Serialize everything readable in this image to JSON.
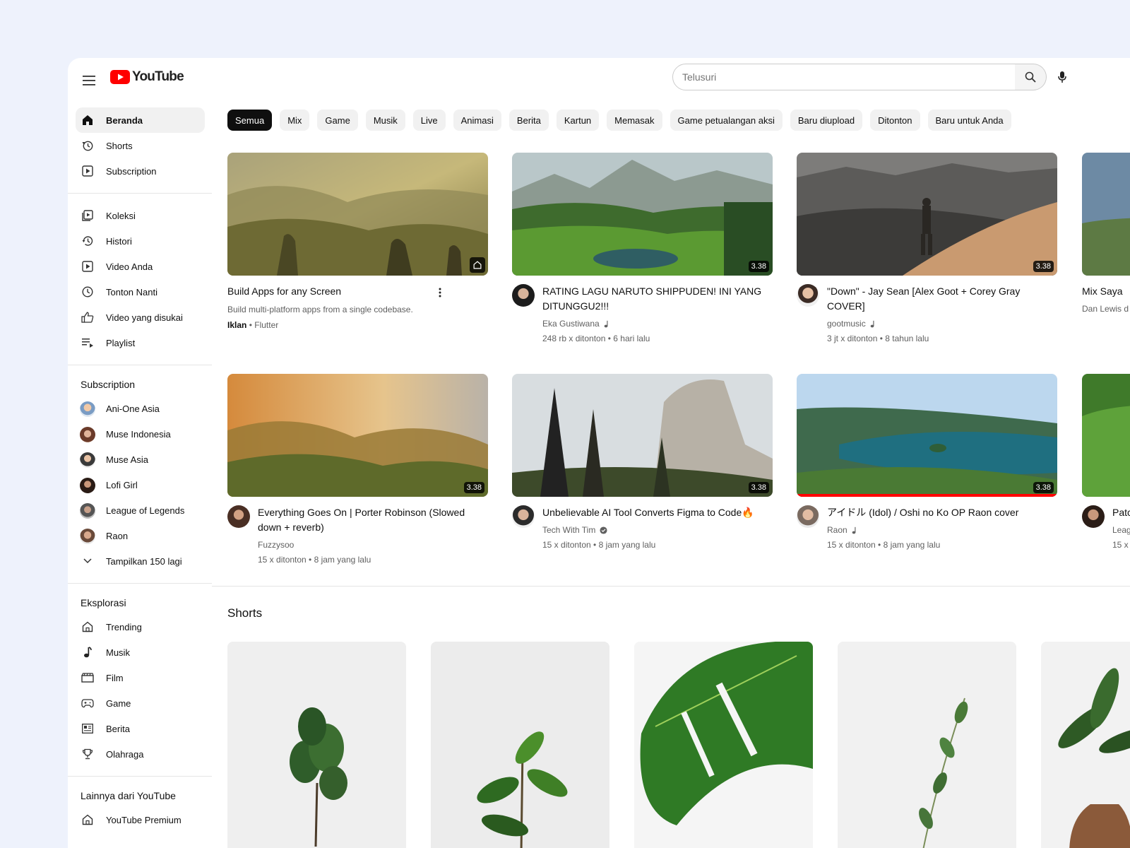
{
  "header": {
    "logo_text": "YouTube",
    "search_placeholder": "Telusuri"
  },
  "sidebar": {
    "main": [
      {
        "label": "Beranda",
        "icon": "home-icon"
      },
      {
        "label": "Shorts",
        "icon": "shorts-icon"
      },
      {
        "label": "Subscription",
        "icon": "subscription-icon"
      }
    ],
    "library": [
      {
        "label": "Koleksi",
        "icon": "library-icon"
      },
      {
        "label": "Histori",
        "icon": "history-icon"
      },
      {
        "label": "Video Anda",
        "icon": "your-videos-icon"
      },
      {
        "label": "Tonton Nanti",
        "icon": "clock-icon"
      },
      {
        "label": "Video yang disukai",
        "icon": "thumbs-up-icon"
      },
      {
        "label": "Playlist",
        "icon": "playlist-icon"
      }
    ],
    "subscription_title": "Subscription",
    "subscriptions": [
      {
        "label": "Ani-One Asia"
      },
      {
        "label": "Muse Indonesia"
      },
      {
        "label": "Muse Asia"
      },
      {
        "label": "Lofi Girl"
      },
      {
        "label": "League of Legends"
      },
      {
        "label": "Raon"
      }
    ],
    "show_more": "Tampilkan 150 lagi",
    "explore_title": "Eksplorasi",
    "explore": [
      {
        "label": "Trending",
        "icon": "trending-icon"
      },
      {
        "label": "Musik",
        "icon": "music-note-icon"
      },
      {
        "label": "Film",
        "icon": "film-icon"
      },
      {
        "label": "Game",
        "icon": "gamepad-icon"
      },
      {
        "label": "Berita",
        "icon": "news-icon"
      },
      {
        "label": "Olahraga",
        "icon": "trophy-icon"
      }
    ],
    "more_title": "Lainnya dari YouTube",
    "more": [
      {
        "label": "YouTube Premium",
        "icon": "premium-icon"
      }
    ]
  },
  "chips": [
    "Semua",
    "Mix",
    "Game",
    "Musik",
    "Live",
    "Animasi",
    "Berita",
    "Kartun",
    "Memasak",
    "Game petualangan aksi",
    "Baru diupload",
    "Ditonton",
    "Baru untuk Anda"
  ],
  "videos": [
    {
      "title": "Build Apps for any Screen",
      "desc": "Build multi-platform apps from a single codebase.",
      "ad_label": "Iklan",
      "sponsor": "Flutter"
    },
    {
      "title": "RATING LAGU NARUTO SHIPPUDEN! INI YANG DITUNGGU2!!!",
      "channel": "Eka Gustiwana",
      "stats": "248 rb x ditonton • 6 hari lalu",
      "duration": "3.38"
    },
    {
      "title": "\"Down\" - Jay Sean [Alex Goot + Corey Gray COVER]",
      "channel": "gootmusic",
      "stats": "3 jt x ditonton • 8 tahun lalu",
      "duration": "3.38"
    },
    {
      "title": "Mix Saya",
      "channel": "Dan Lewis d"
    },
    {
      "title": "Everything Goes On | Porter Robinson (Slowed down + reverb)",
      "channel": "Fuzzysoo",
      "stats": "15 x ditonton • 8 jam yang lalu",
      "duration": "3.38"
    },
    {
      "title": "Unbelievable AI Tool Converts Figma to Code🔥",
      "channel": "Tech With Tim",
      "stats": "15 x ditonton • 8 jam yang lalu",
      "duration": "3.38"
    },
    {
      "title": "アイドル (Idol) / Oshi no Ko OP  Raon cover",
      "channel": "Raon",
      "stats": "15 x ditonton • 8 jam yang lalu",
      "duration": "3.38",
      "watch_progress": 1.0
    },
    {
      "title": "Patc",
      "channel": "Leag",
      "stats": "15 x"
    }
  ],
  "shorts_title": "Shorts",
  "colors": {
    "brand_red": "#ff0000",
    "chip_bg": "#f1f1f1",
    "text_secondary": "#606060",
    "page_bg": "#eef2fc"
  }
}
